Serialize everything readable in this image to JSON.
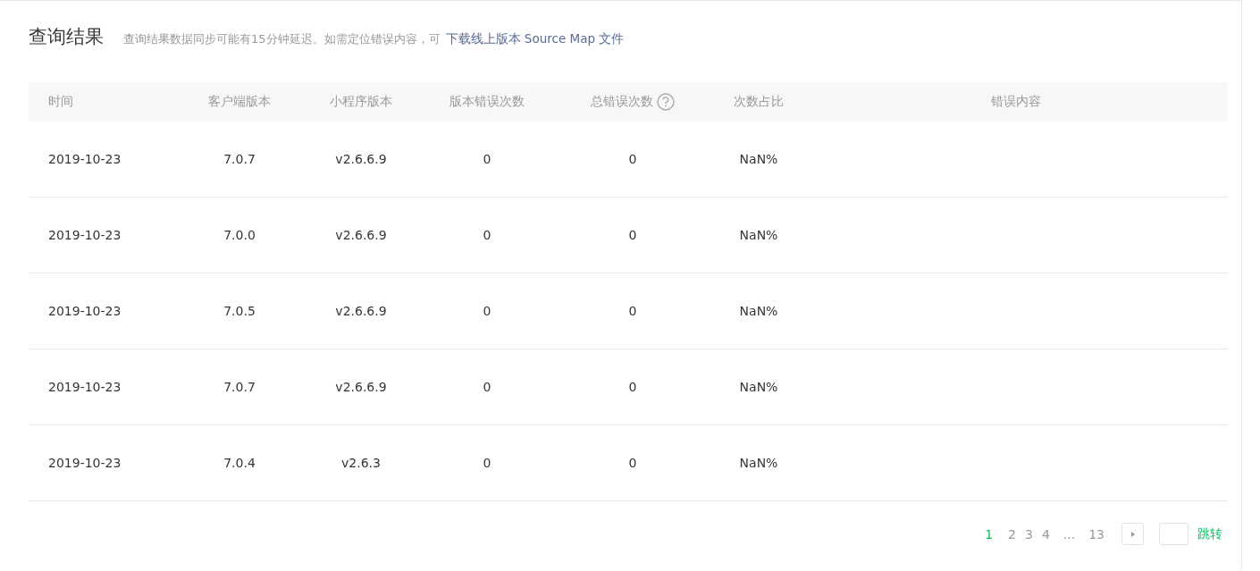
{
  "section": {
    "title": "查询结果",
    "notice": "查询结果数据同步可能有15分钟延迟。如需定位错误内容，可",
    "link": "下载线上版本 Source Map 文件"
  },
  "table": {
    "columns": [
      {
        "label": "时间",
        "help": false
      },
      {
        "label": "客户端版本",
        "help": false
      },
      {
        "label": "小程序版本",
        "help": false
      },
      {
        "label": "版本错误次数",
        "help": false
      },
      {
        "label": "总错误次数",
        "help": true
      },
      {
        "label": "次数占比",
        "help": false
      },
      {
        "label": "错误内容",
        "help": false
      }
    ],
    "rows": [
      [
        "2019-10-23",
        "7.0.7",
        "v2.6.6.9",
        "0",
        "0",
        "NaN%"
      ],
      [
        "2019-10-23",
        "7.0.0",
        "v2.6.6.9",
        "0",
        "0",
        "NaN%"
      ],
      [
        "2019-10-23",
        "7.0.5",
        "v2.6.6.9",
        "0",
        "0",
        "NaN%"
      ],
      [
        "2019-10-23",
        "7.0.7",
        "v2.6.6.9",
        "0",
        "0",
        "NaN%"
      ],
      [
        "2019-10-23",
        "7.0.4",
        "v2.6.3",
        "0",
        "0",
        "NaN%"
      ]
    ]
  },
  "pagination": {
    "items": [
      {
        "kind": "page",
        "label": "1",
        "selected": true
      },
      {
        "kind": "page",
        "label": "2",
        "selected": false
      },
      {
        "kind": "page",
        "label": "3",
        "selected": false
      },
      {
        "kind": "page",
        "label": "4",
        "selected": false
      },
      {
        "kind": "ellipsis",
        "label": "..."
      },
      {
        "kind": "page",
        "label": "13",
        "selected": false
      }
    ],
    "jump_label": "跳转"
  }
}
